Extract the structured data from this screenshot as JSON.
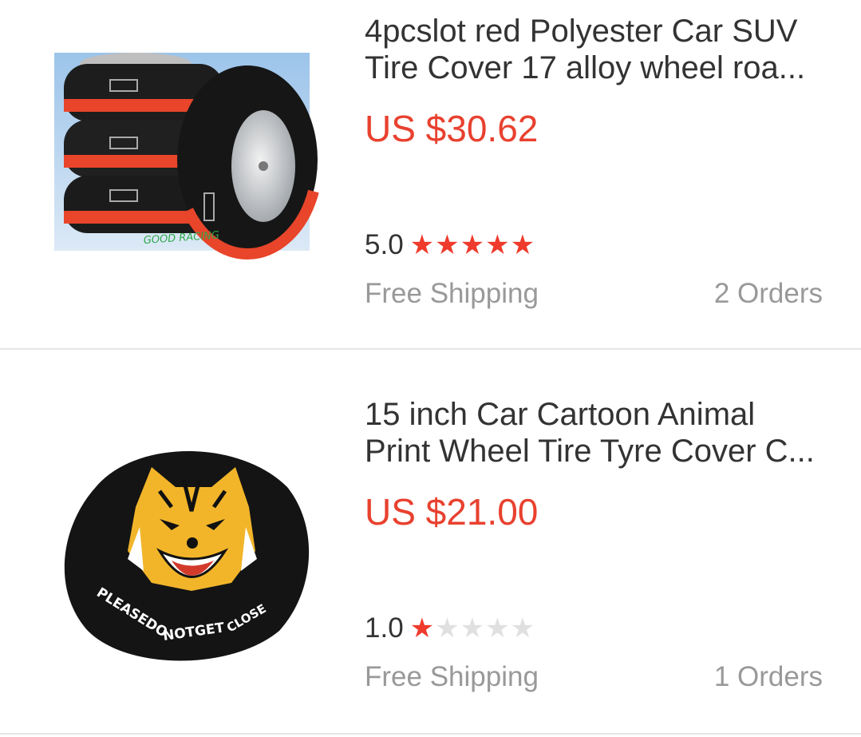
{
  "products": [
    {
      "title_line1": "4pcslot red Polyester Car SUV",
      "title_line2": "Tire Cover 17 alloy wheel roa...",
      "price": "US $30.62",
      "rating": "5.0",
      "stars_filled": 5,
      "shipping": "Free Shipping",
      "orders": "2 Orders",
      "image_text": "GOOD RACING"
    },
    {
      "title_line1": "15 inch Car Cartoon Animal",
      "title_line2": "Print Wheel Tire Tyre Cover C...",
      "price": "US $21.00",
      "rating": "1.0",
      "stars_filled": 1,
      "shipping": "Free Shipping",
      "orders": "1 Orders",
      "image_text": "PLEASEDONOTGET CLOSE"
    }
  ],
  "colors": {
    "price": "#e8412f",
    "star_on": "#ef3b2c",
    "star_off": "#e0e0e0",
    "muted": "#999999",
    "text": "#333333"
  }
}
